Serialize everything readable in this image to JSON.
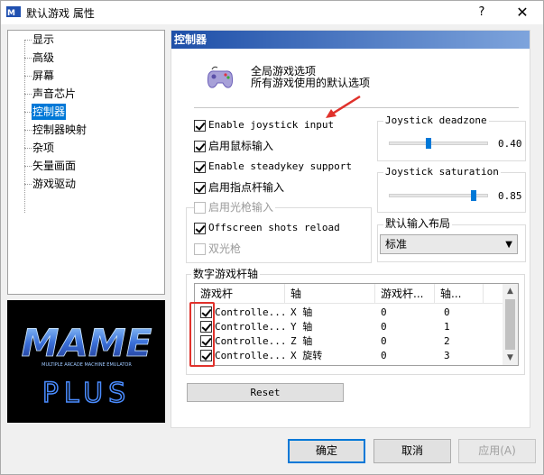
{
  "window": {
    "title": "默认游戏 属性",
    "help_glyph": "?",
    "close_glyph": "✕"
  },
  "tree": {
    "items": [
      {
        "label": "显示",
        "selected": false
      },
      {
        "label": "高级",
        "selected": false
      },
      {
        "label": "屏幕",
        "selected": false
      },
      {
        "label": "声音芯片",
        "selected": false
      },
      {
        "label": "控制器",
        "selected": true
      },
      {
        "label": "控制器映射",
        "selected": false
      },
      {
        "label": "杂项",
        "selected": false
      },
      {
        "label": "矢量画面",
        "selected": false
      },
      {
        "label": "游戏驱动",
        "selected": false
      }
    ]
  },
  "logo": {
    "main_text": "MAME",
    "sub_text": "MULTIPLE ARCADE MACHINE EMULATOR",
    "plus_text": "PLUS"
  },
  "panel": {
    "header": "控制器",
    "desc_title": "全局游戏选项",
    "desc_sub": "所有游戏使用的默认选项"
  },
  "options": {
    "enable_joystick": {
      "label": "Enable joystick input",
      "checked": true
    },
    "enable_mouse": {
      "label": "启用鼠标输入",
      "checked": true
    },
    "enable_steadykey": {
      "label": "Enable steadykey support",
      "checked": true
    },
    "enable_stick": {
      "label": "启用指点杆输入",
      "checked": true
    },
    "gun_group": {
      "enable_lightgun": {
        "label": "启用光枪输入",
        "checked": false,
        "disabled": true
      },
      "offscreen_reload": {
        "label": "Offscreen shots reload",
        "checked": true
      },
      "dual_lightgun": {
        "label": "双光枪",
        "checked": false,
        "disabled": true
      }
    }
  },
  "deadzone": {
    "title": "Joystick deadzone",
    "value": "0.40",
    "level": 0.4
  },
  "saturation": {
    "title": "Joystick saturation",
    "value": "0.85",
    "level": 0.85
  },
  "layout": {
    "title": "默认输入布局",
    "selected": "标准",
    "arrow": "▼"
  },
  "axes": {
    "title": "数字游戏杆轴",
    "columns": [
      "游戏杆",
      "轴",
      "游戏杆...",
      "轴..."
    ],
    "rows": [
      {
        "checked": true,
        "joystick": "Controlle...",
        "axis": "X 轴",
        "jnum": "0",
        "anum": "0"
      },
      {
        "checked": true,
        "joystick": "Controlle...",
        "axis": "Y 轴",
        "jnum": "0",
        "anum": "1"
      },
      {
        "checked": true,
        "joystick": "Controlle...",
        "axis": "Z 轴",
        "jnum": "0",
        "anum": "2"
      },
      {
        "checked": true,
        "joystick": "Controlle...",
        "axis": "X 旋转",
        "jnum": "0",
        "anum": "3"
      }
    ],
    "scroll_up": "▲",
    "scroll_down": "▼"
  },
  "reset_label": "Reset",
  "buttons": {
    "ok": "确定",
    "cancel": "取消",
    "apply": "应用(A)"
  },
  "colors": {
    "accent": "#0078d7",
    "annotation_red": "#e0312b",
    "header_start": "#1e4fa8",
    "header_end": "#7ea4dc"
  }
}
